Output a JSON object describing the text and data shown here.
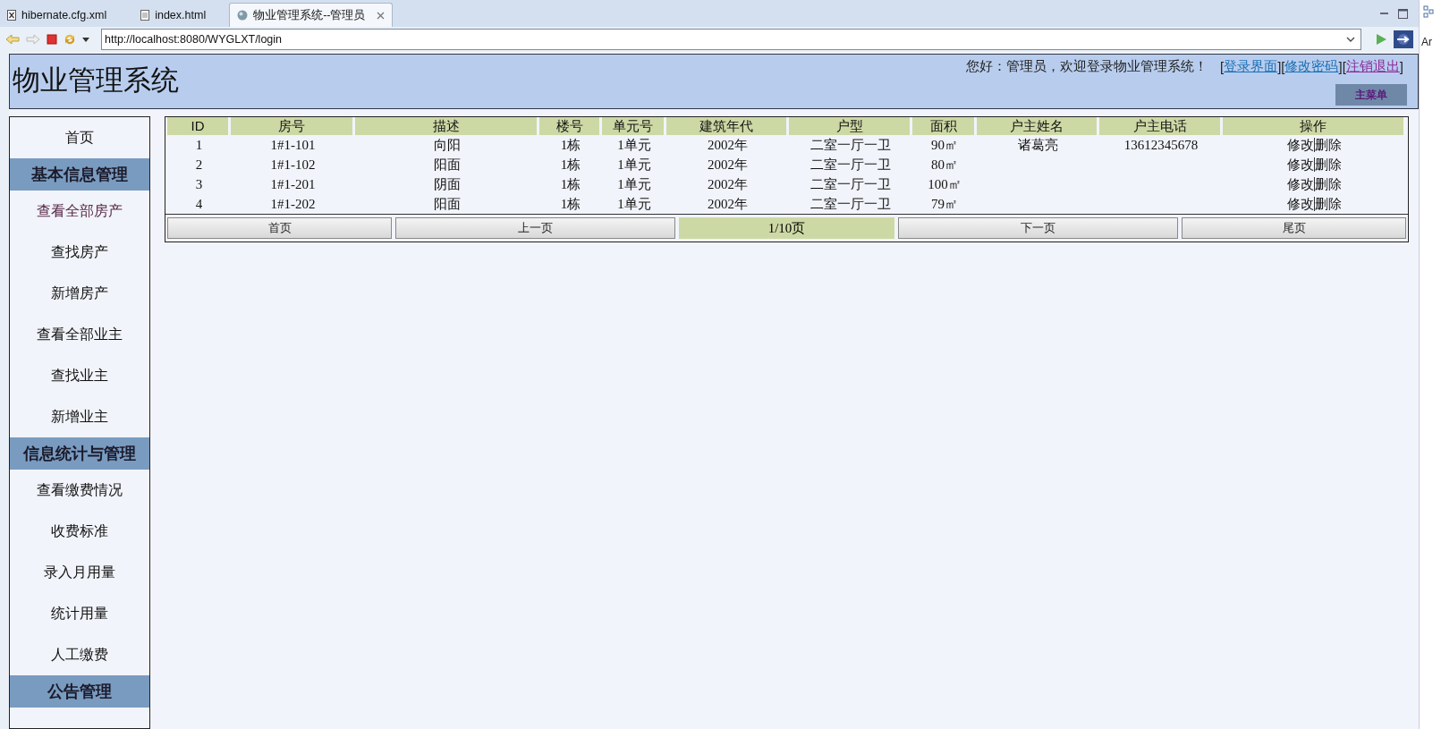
{
  "editor_tabs": [
    {
      "label": "hibernate.cfg.xml",
      "kind": "xml",
      "selected": false
    },
    {
      "label": "index.html",
      "kind": "file",
      "selected": false
    },
    {
      "label": "物业管理系统--管理员",
      "kind": "web",
      "selected": true
    }
  ],
  "address_bar": {
    "value": "http://localhost:8080/WYGLXT/login"
  },
  "side_panel": {
    "text": "Ar"
  },
  "header": {
    "title": "物业管理系统",
    "greeting": "您好：管理员，欢迎登录物业管理系统！",
    "links": [
      {
        "kind": "bracket",
        "text": "["
      },
      {
        "kind": "link",
        "text": "登录界面",
        "visited": false
      },
      {
        "kind": "bracket",
        "text": "]"
      },
      {
        "kind": "bracket",
        "text": "["
      },
      {
        "kind": "link",
        "text": "修改密码",
        "visited": false
      },
      {
        "kind": "bracket",
        "text": "]"
      },
      {
        "kind": "bracket",
        "text": "["
      },
      {
        "kind": "link",
        "text": "注销退出",
        "visited": true
      },
      {
        "kind": "bracket",
        "text": "]"
      }
    ],
    "menu_button": "主菜单"
  },
  "sidebar": {
    "items": [
      {
        "kind": "item",
        "label": "首页",
        "visited": false
      },
      {
        "kind": "heading",
        "label": "基本信息管理"
      },
      {
        "kind": "item",
        "label": "查看全部房产",
        "visited": true
      },
      {
        "kind": "item",
        "label": "查找房产",
        "visited": false
      },
      {
        "kind": "item",
        "label": "新增房产",
        "visited": false
      },
      {
        "kind": "item",
        "label": "查看全部业主",
        "visited": false
      },
      {
        "kind": "item",
        "label": "查找业主",
        "visited": false
      },
      {
        "kind": "item",
        "label": "新增业主",
        "visited": false
      },
      {
        "kind": "heading",
        "label": "信息统计与管理"
      },
      {
        "kind": "item",
        "label": "查看缴费情况",
        "visited": false
      },
      {
        "kind": "item",
        "label": "收费标准",
        "visited": false
      },
      {
        "kind": "item",
        "label": "录入月用量",
        "visited": false
      },
      {
        "kind": "item",
        "label": "统计用量",
        "visited": false
      },
      {
        "kind": "item",
        "label": "人工缴费",
        "visited": false
      },
      {
        "kind": "heading",
        "label": "公告管理"
      }
    ]
  },
  "table": {
    "columns": [
      "ID",
      "房号",
      "描述",
      "楼号",
      "单元号",
      "建筑年代",
      "户型",
      "面积",
      "户主姓名",
      "户主电话",
      "操作"
    ],
    "rows": [
      {
        "cells": [
          "1",
          "1#1-101",
          "向阳",
          "1栋",
          "1单元",
          "2002年",
          "二室一厅一卫",
          "90㎡",
          "诸葛亮",
          "13612345678"
        ],
        "actions": [
          "修改",
          "删除"
        ]
      },
      {
        "cells": [
          "2",
          "1#1-102",
          "阳面",
          "1栋",
          "1单元",
          "2002年",
          "二室一厅一卫",
          "80㎡",
          "",
          ""
        ],
        "actions": [
          "修改",
          "删除"
        ]
      },
      {
        "cells": [
          "3",
          "1#1-201",
          "阴面",
          "1栋",
          "1单元",
          "2002年",
          "二室一厅一卫",
          "100㎡",
          "",
          ""
        ],
        "actions": [
          "修改",
          "删除"
        ]
      },
      {
        "cells": [
          "4",
          "1#1-202",
          "阳面",
          "1栋",
          "1单元",
          "2002年",
          "二室一厅一卫",
          "79㎡",
          "",
          ""
        ],
        "actions": [
          "修改",
          "删除"
        ]
      }
    ]
  },
  "pager": {
    "first": "首页",
    "prev": "上一页",
    "page": "1/10页",
    "next": "下一页",
    "last": "尾页"
  }
}
